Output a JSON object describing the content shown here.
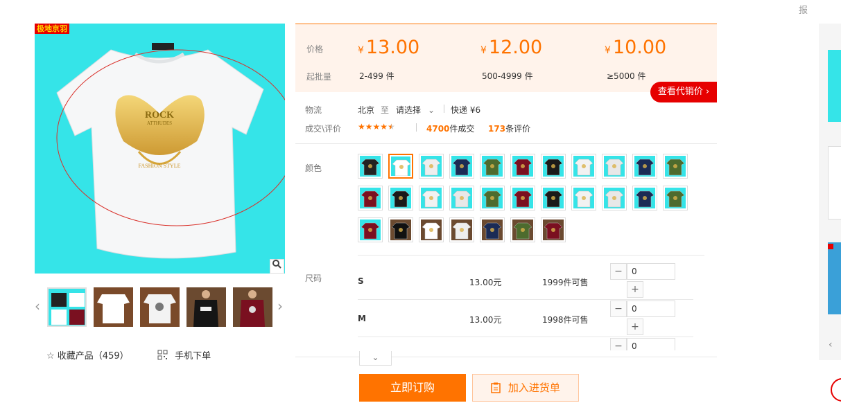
{
  "top_right_text": "报",
  "brand_tag": "极地京羽",
  "shirt_print": {
    "line1": "ROCK",
    "line2": "ATTHUDES",
    "line3": "FASHION STYLE"
  },
  "zoom_icon": "magnifier-icon",
  "thumb_prev": "‹",
  "thumb_next": "›",
  "favorite": {
    "icon": "star-outline-icon",
    "label": "收藏产品（459）"
  },
  "mobile_order": {
    "icon": "qr-code-icon",
    "label": "手机下单"
  },
  "price_panel": {
    "price_label": "价格",
    "moq_label": "起批量",
    "currency": "¥",
    "tiers": [
      {
        "price": "13.00",
        "qty": "2-499 件"
      },
      {
        "price": "12.00",
        "qty": "500-4999 件"
      },
      {
        "price": "10.00",
        "qty": "≥5000 件"
      }
    ]
  },
  "agent_button": "查看代销价 ›",
  "logistics": {
    "label": "物流",
    "from": "北京",
    "to_word": "至",
    "select": "请选择",
    "express": "快递 ¥6"
  },
  "reviews": {
    "label": "成交\\评价",
    "rating": 4.5,
    "deals_num": "4700",
    "deals_word": "件成交",
    "reviews_num": "173",
    "reviews_word": "条评价"
  },
  "color_label": "颜色",
  "colors": {
    "bg_cyan": "#35e4e8",
    "accent": "#ff7300",
    "red": "#e60000"
  },
  "size_label": "尺码",
  "sizes": [
    {
      "name": "S",
      "price": "13.00元",
      "stock": "1999件可售",
      "qty": "0"
    },
    {
      "name": "M",
      "price": "13.00元",
      "stock": "1998件可售",
      "qty": "0"
    },
    {
      "name": "",
      "price": "",
      "stock": "",
      "qty": "0"
    }
  ],
  "buy_button": "立即订购",
  "cart_button": "加入进货单",
  "expand_icon": "chevron-down-icon"
}
